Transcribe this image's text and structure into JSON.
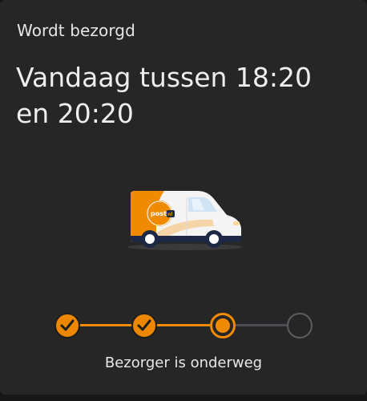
{
  "delivery": {
    "status": "Wordt bezorgd",
    "time_window": "Vandaag tussen 18:20 en 20:20"
  },
  "illustration": {
    "icon": "delivery-van-icon",
    "brand_text": "post nl",
    "colors": {
      "orange": "#f08a00",
      "body": "#f4f4f4",
      "navy": "#1c2845"
    }
  },
  "progress": {
    "total_steps": 4,
    "completed_steps": 2,
    "current_step": 3,
    "caption": "Bezorger is onderweg",
    "colors": {
      "active": "#f08a00",
      "inactive": "#4a4d52"
    }
  }
}
